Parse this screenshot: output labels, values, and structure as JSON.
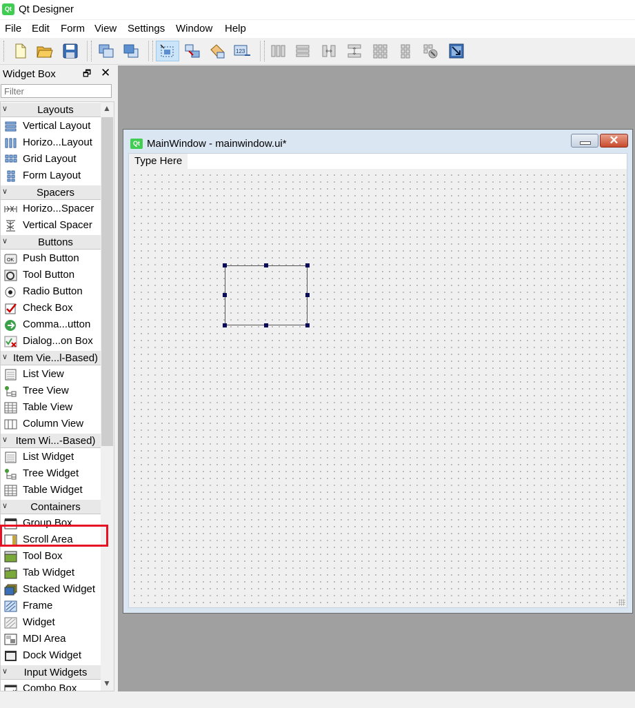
{
  "app": {
    "icon_text": "Qt",
    "title": "Qt Designer"
  },
  "menubar": [
    "File",
    "Edit",
    "Form",
    "View",
    "Settings",
    "Window",
    "Help"
  ],
  "toolbar": {
    "buttons": [
      {
        "name": "new-form-icon"
      },
      {
        "name": "open-icon"
      },
      {
        "name": "save-icon"
      },
      {
        "name": "send-to-back-icon"
      },
      {
        "name": "bring-to-front-icon"
      },
      {
        "name": "edit-widgets-icon",
        "active": true
      },
      {
        "name": "edit-signals-slots-icon"
      },
      {
        "name": "edit-buddies-icon"
      },
      {
        "name": "edit-tab-order-icon"
      },
      {
        "name": "lay-out-horizontally-icon"
      },
      {
        "name": "lay-out-vertically-icon"
      },
      {
        "name": "horizontal-splitter-icon"
      },
      {
        "name": "vertical-splitter-icon"
      },
      {
        "name": "lay-out-grid-icon"
      },
      {
        "name": "lay-out-form-icon"
      },
      {
        "name": "break-layout-icon"
      },
      {
        "name": "adjust-size-icon"
      }
    ]
  },
  "widget_box": {
    "title": "Widget Box",
    "float_icon": "float-icon",
    "close_icon": "close-icon",
    "filter_placeholder": "Filter",
    "rows": [
      {
        "type": "category",
        "label": "Layouts"
      },
      {
        "type": "item",
        "label": "Vertical Layout",
        "icon": "vertical-layout-icon"
      },
      {
        "type": "item",
        "label": "Horizo...Layout",
        "icon": "horizontal-layout-icon"
      },
      {
        "type": "item",
        "label": "Grid Layout",
        "icon": "grid-layout-icon"
      },
      {
        "type": "item",
        "label": "Form Layout",
        "icon": "form-layout-icon"
      },
      {
        "type": "category",
        "label": "Spacers"
      },
      {
        "type": "item",
        "label": "Horizo...Spacer",
        "icon": "horizontal-spacer-icon"
      },
      {
        "type": "item",
        "label": "Vertical Spacer",
        "icon": "vertical-spacer-icon"
      },
      {
        "type": "category",
        "label": "Buttons"
      },
      {
        "type": "item",
        "label": "Push Button",
        "icon": "push-button-icon"
      },
      {
        "type": "item",
        "label": "Tool Button",
        "icon": "tool-button-icon"
      },
      {
        "type": "item",
        "label": "Radio Button",
        "icon": "radio-button-icon"
      },
      {
        "type": "item",
        "label": "Check Box",
        "icon": "check-box-icon"
      },
      {
        "type": "item",
        "label": "Comma...utton",
        "icon": "command-link-icon"
      },
      {
        "type": "item",
        "label": "Dialog...on Box",
        "icon": "dialog-button-box-icon"
      },
      {
        "type": "category",
        "label": "Item Vie...l-Based)"
      },
      {
        "type": "item",
        "label": "List View",
        "icon": "list-view-icon"
      },
      {
        "type": "item",
        "label": "Tree View",
        "icon": "tree-view-icon"
      },
      {
        "type": "item",
        "label": "Table View",
        "icon": "table-view-icon"
      },
      {
        "type": "item",
        "label": "Column View",
        "icon": "column-view-icon"
      },
      {
        "type": "category",
        "label": "Item Wi...-Based)"
      },
      {
        "type": "item",
        "label": "List Widget",
        "icon": "list-widget-icon"
      },
      {
        "type": "item",
        "label": "Tree Widget",
        "icon": "tree-widget-icon"
      },
      {
        "type": "item",
        "label": "Table Widget",
        "icon": "table-widget-icon"
      },
      {
        "type": "category",
        "label": "Containers"
      },
      {
        "type": "item",
        "label": "Group Box",
        "icon": "group-box-icon"
      },
      {
        "type": "item",
        "label": "Scroll Area",
        "icon": "scroll-area-icon",
        "highlighted": true
      },
      {
        "type": "item",
        "label": "Tool Box",
        "icon": "tool-box-icon"
      },
      {
        "type": "item",
        "label": "Tab Widget",
        "icon": "tab-widget-icon"
      },
      {
        "type": "item",
        "label": "Stacked Widget",
        "icon": "stacked-widget-icon"
      },
      {
        "type": "item",
        "label": "Frame",
        "icon": "frame-icon"
      },
      {
        "type": "item",
        "label": "Widget",
        "icon": "widget-icon"
      },
      {
        "type": "item",
        "label": "MDI Area",
        "icon": "mdi-area-icon"
      },
      {
        "type": "item",
        "label": "Dock Widget",
        "icon": "dock-widget-icon"
      },
      {
        "type": "category",
        "label": "Input Widgets"
      },
      {
        "type": "item",
        "label": "Combo Box",
        "icon": "combo-box-icon"
      }
    ]
  },
  "form_window": {
    "icon_text": "Qt",
    "title": "MainWindow - mainwindow.ui*",
    "menu_placeholder": "Type Here"
  },
  "colors": {
    "highlight": "#e81123",
    "qt_green": "#41cd52",
    "handle": "#0b0b5c"
  }
}
